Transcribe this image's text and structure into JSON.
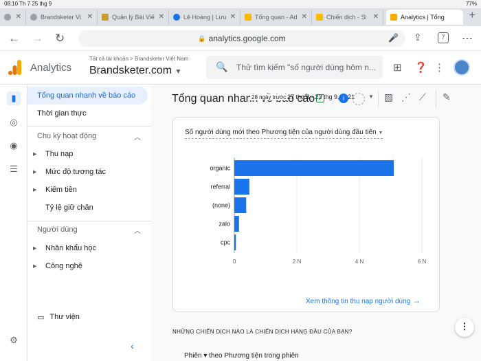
{
  "statusbar": {
    "left": "08:10  Th 7 25 thg 9",
    "right": "77%"
  },
  "tabs": [
    {
      "label": "",
      "color": "#9aa0a6"
    },
    {
      "label": "Brandsketer Vi",
      "color": "#9aa0a6"
    },
    {
      "label": "Quản lý Bài Viết",
      "color": "#c69c2c"
    },
    {
      "label": "Lê Hoàng | Lưu",
      "color": "#1a73e8"
    },
    {
      "label": "Tổng quan - Ad",
      "color": "#fbbc04"
    },
    {
      "label": "Chiến dịch - Si",
      "color": "#fbbc04"
    },
    {
      "label": "Analytics | Tổng",
      "color": "#f9ab00"
    }
  ],
  "browser": {
    "url": "analytics.google.com",
    "tab_count": "7"
  },
  "header": {
    "app_name": "Analytics",
    "breadcrumb": "Tất cả tài khoản > Brandsketer Việt Nam",
    "property": "Brandsketer.com",
    "search_placeholder": "Thử tìm kiếm \"số người dùng hôm n..."
  },
  "nav": {
    "overview": "Tổng quan nhanh về báo cáo",
    "realtime": "Thời gian thực",
    "lifecycle": "Chu kỳ hoạt động",
    "lifecycle_items": [
      "Thu nạp",
      "Mức độ tương tác",
      "Kiếm tiền",
      "Tỷ lệ giữ chân"
    ],
    "users": "Người dùng",
    "users_items": [
      "Nhân khẩu học",
      "Công nghệ"
    ],
    "library": "Thư viện"
  },
  "page": {
    "title": "Tổng quan nhanh về báo cáo",
    "updated": "28 ngày trước",
    "date_fragment": "27 thg 8 - 23 thg 9, 2021"
  },
  "card": {
    "title": "Số người dùng mới theo Phương tiện của người dùng đầu tiên",
    "link": "Xem thông tin thu nạp người dùng"
  },
  "section2": {
    "heading": "NHỮNG CHIẾN DỊCH NÀO LÀ CHIẾN DỊCH HÀNG ĐẦU CỦA BẠN?",
    "filter": "Phiên ▾  theo Phương tiện trong phiên"
  },
  "chart_data": {
    "type": "bar",
    "orientation": "horizontal",
    "categories": [
      "organic",
      "referral",
      "(none)",
      "zalo",
      "cpc"
    ],
    "values": [
      5100000,
      480000,
      380000,
      150000,
      50000
    ],
    "xlim": [
      0,
      6000000
    ],
    "xticks": [
      "0",
      "2 N",
      "4 N",
      "6 N"
    ],
    "bar_color": "#1a73e8"
  }
}
